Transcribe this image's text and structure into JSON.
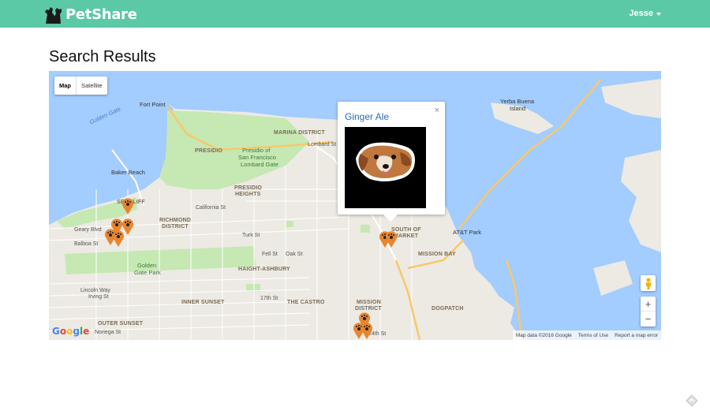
{
  "app": {
    "name": "PetShare"
  },
  "nav": {
    "user_label": "Jesse"
  },
  "page": {
    "title": "Search Results"
  },
  "map": {
    "type_controls": {
      "map_label": "Map",
      "satellite_label": "Satellite"
    },
    "labels": {
      "fort_point": "Fort Point",
      "golden_gate": "Golden Gate",
      "presidio": "PRESIDIO",
      "presidio_of_sf": "Presidio of",
      "presidio_of_sf_2": "San Francisco",
      "lombard_gate": "Lombard Gate",
      "marina": "MARINA DISTRICT",
      "lombard_st": "Lombard St",
      "baker_beach": "Baker Beach",
      "presidio_heights": "PRESIDIO",
      "presidio_heights_2": "HEIGHTS",
      "seacliff": "SEACLIFF",
      "richmond": "RICHMOND",
      "richmond_2": "DISTRICT",
      "california_st": "California St",
      "geary_blvd": "Geary Blvd",
      "balboa_st": "Balboa St",
      "turk_st": "Turk St",
      "golden_gate_park": "Golden",
      "golden_gate_park_2": "Gate Park",
      "lincoln_way": "Lincoln Way",
      "haight_ashbury": "HAIGHT-ASHBURY",
      "inner_sunset": "INNER SUNSET",
      "outer_sunset": "OUTER SUNSET",
      "the_castro": "THE CASTRO",
      "mission_district": "MISSION",
      "mission_district_2": "DISTRICT",
      "south_of_market": "SOUTH OF",
      "south_of_market_2": "MARKET",
      "mission_bay": "MISSION BAY",
      "att_park": "AT&T Park",
      "dogpatch": "DOGPATCH",
      "yerba_buena": "Yerba Buena",
      "yerba_buena_2": "Island",
      "fell_st": "Fell St",
      "oak_st": "Oak St",
      "17th_st": "17th St",
      "24th_st": "24th St",
      "irving_st": "Irving St",
      "noriega_st": "Noriega St"
    },
    "google_logo": "Google",
    "footer": {
      "map_data": "Map data ©2016 Google",
      "terms": "Terms of Use",
      "report": "Report a map error"
    },
    "info_window": {
      "pet_name": "Ginger Ale",
      "close_symbol": "×"
    },
    "marker_color": "#e8852e"
  },
  "colors": {
    "navbar": "#5bc9a5",
    "water": "#a3ccff",
    "park": "#c6e8b3",
    "land": "#eceae3",
    "link": "#2a6fb8"
  }
}
